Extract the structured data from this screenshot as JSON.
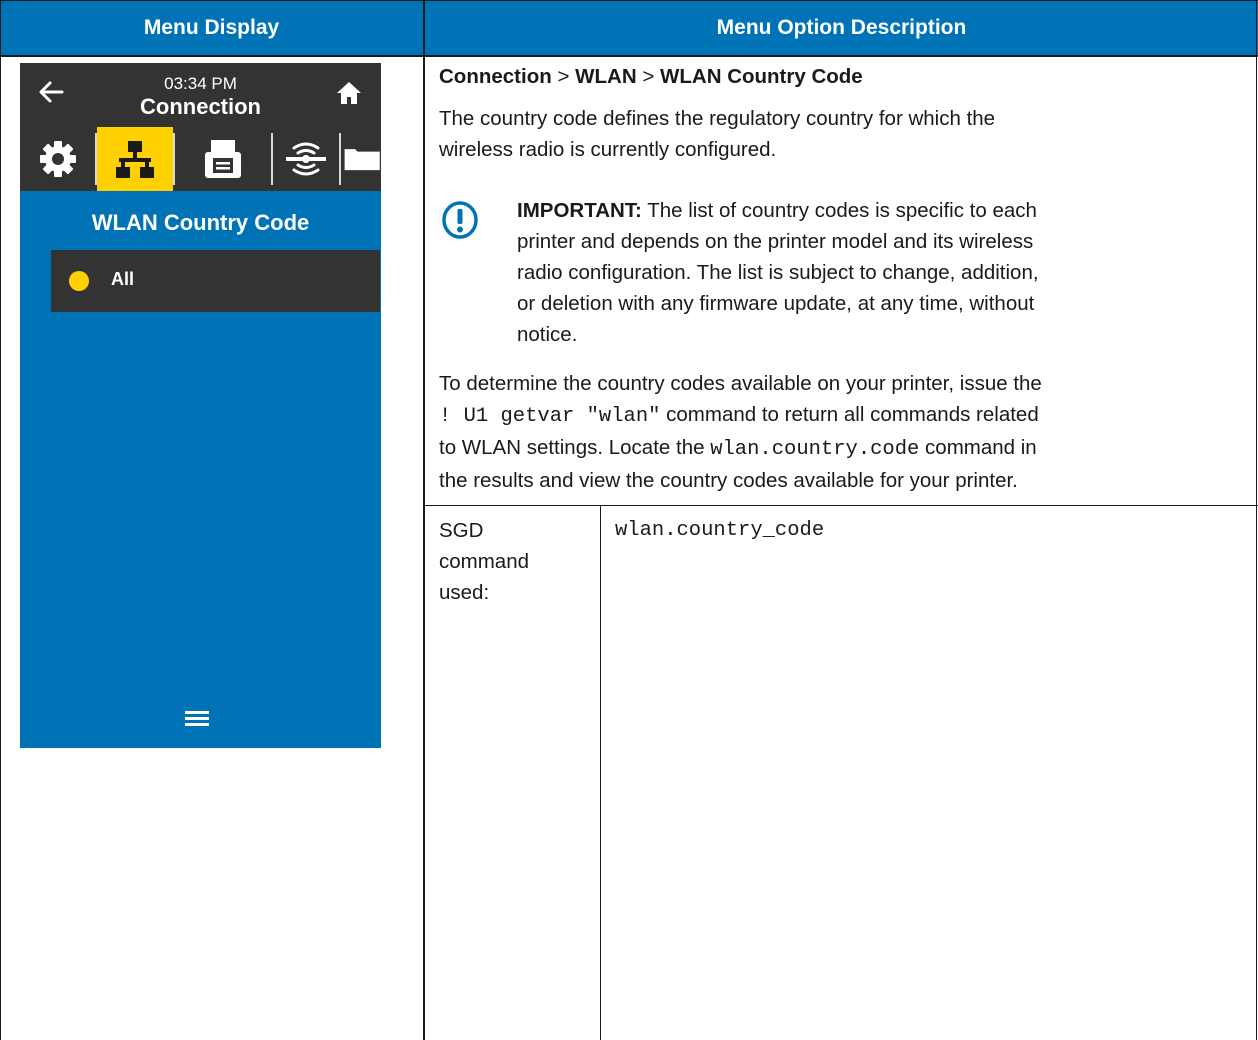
{
  "table": {
    "col1_header": "Menu Display",
    "col2_header": "Menu Option Description"
  },
  "screen": {
    "time": "03:34 PM",
    "title": "Connection",
    "icons": [
      "back-arrow-icon",
      "home-icon",
      "gear-icon",
      "network-icon",
      "printer-icon",
      "wireless-icon",
      "folder-icon",
      "menu-icon"
    ],
    "heading": "WLAN Country Code",
    "option_label": "All",
    "colors": {
      "panel_blue": "#0073b6",
      "dark_bar": "#333333",
      "selected_yellow": "#ffd100"
    }
  },
  "description": {
    "breadcrumb": [
      "Connection",
      ">",
      "WLAN",
      ">",
      "WLAN Country Code"
    ],
    "intro": [
      "The country code defines the regulatory country for which the",
      "wireless radio is currently configured."
    ],
    "important_label": "IMPORTANT:",
    "important_lines": [
      " The list of country codes is specific to each",
      "printer and depends on the printer model and its wireless",
      "radio configuration. The list is subject to change, addition,",
      "or deletion with any firmware update, at any time, without",
      "notice."
    ],
    "determine": {
      "line1": "To determine the country codes available on your printer, issue the",
      "cmd": "! U1 getvar \"wlan\"",
      "line2_rest": " command to return all commands related",
      "line3_start": "to WLAN settings. Locate the ",
      "code": "wlan.country.code",
      "line3_end": " command in",
      "line4": "the results and view the country codes available for your printer."
    }
  },
  "sgd": {
    "label_lines": [
      "SGD",
      "command",
      "used:"
    ],
    "value": "wlan.country_code"
  }
}
